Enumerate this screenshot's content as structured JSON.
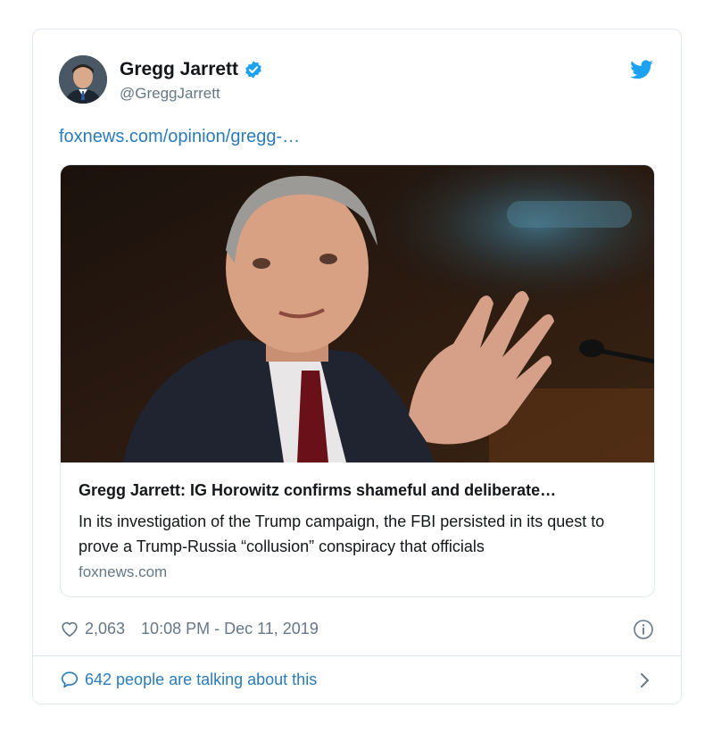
{
  "author": {
    "name": "Gregg Jarrett",
    "handle": "@GreggJarrett",
    "verified": true
  },
  "tweet": {
    "link_text": "foxnews.com/opinion/gregg-…"
  },
  "preview": {
    "title": "Gregg Jarrett: IG Horowitz confirms shameful and deliberate…",
    "description": "In its investigation of the Trump campaign, the FBI persisted in its quest to prove a Trump-Russia “collusion” conspiracy that officials",
    "domain": "foxnews.com"
  },
  "footer": {
    "likes": "2,063",
    "timestamp": "10:08 PM - Dec 11, 2019",
    "talking": "642 people are talking about this"
  },
  "icons": {
    "like": "heart-icon",
    "info": "info-icon",
    "comment": "speech-bubble-icon",
    "brand": "twitter-bird-icon",
    "verified": "verified-check-icon",
    "chevron": "chevron-right-icon"
  },
  "colors": {
    "link": "#2b7bb9",
    "secondary_text": "#657786",
    "brand": "#1da1f2",
    "border": "#e1e8ed"
  }
}
